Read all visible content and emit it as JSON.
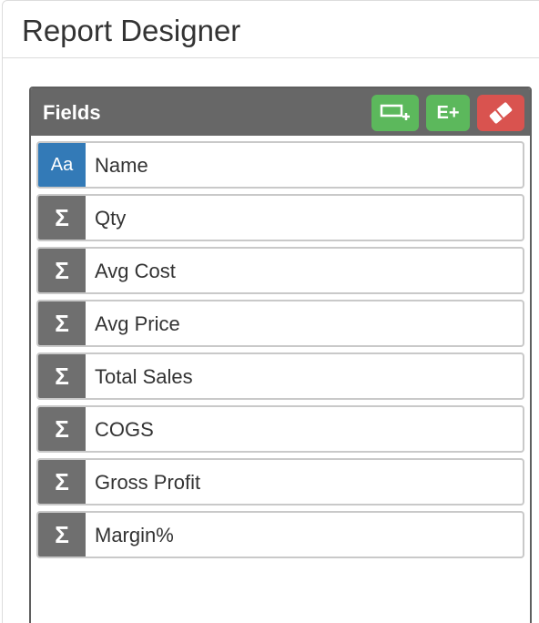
{
  "page": {
    "title": "Report Designer"
  },
  "fields_panel": {
    "title": "Fields",
    "add_expression_label": "E+",
    "icons": {
      "add_field": "add-field-icon",
      "clear": "eraser-icon"
    },
    "colors": {
      "header_bg": "#676767",
      "add_button": "#5cb85c",
      "clear_button": "#d9534f",
      "text_type": "#337ab7",
      "numeric_type": "#6f6f6f"
    },
    "items": [
      {
        "type": "text",
        "type_label": "Aa",
        "label": "Name"
      },
      {
        "type": "numeric",
        "type_label": "Σ",
        "label": "Qty"
      },
      {
        "type": "numeric",
        "type_label": "Σ",
        "label": "Avg Cost"
      },
      {
        "type": "numeric",
        "type_label": "Σ",
        "label": "Avg Price"
      },
      {
        "type": "numeric",
        "type_label": "Σ",
        "label": "Total Sales"
      },
      {
        "type": "numeric",
        "type_label": "Σ",
        "label": "COGS"
      },
      {
        "type": "numeric",
        "type_label": "Σ",
        "label": "Gross Profit"
      },
      {
        "type": "numeric",
        "type_label": "Σ",
        "label": "Margin%"
      }
    ]
  }
}
